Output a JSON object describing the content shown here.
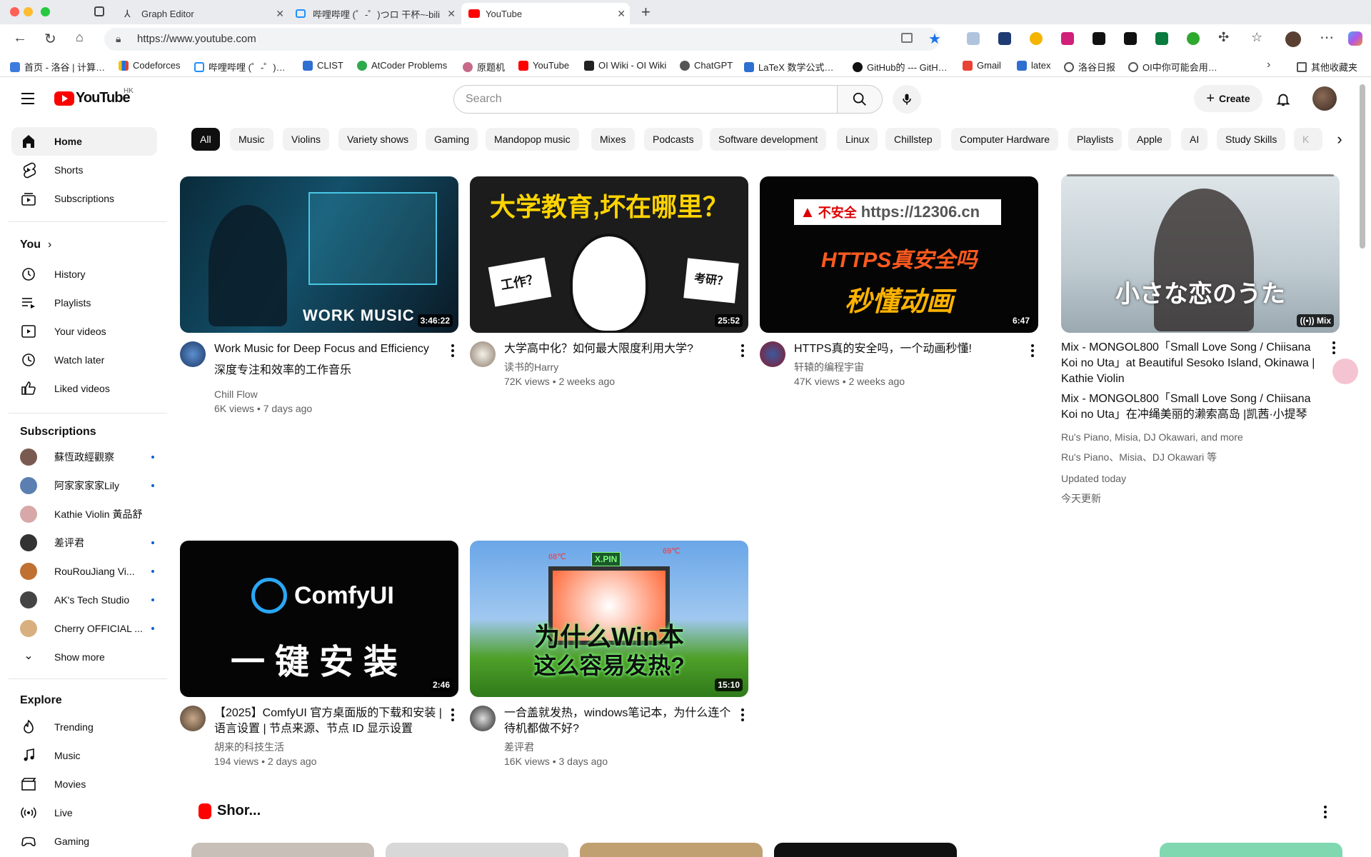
{
  "browser": {
    "tabs": [
      {
        "title": "Graph Editor"
      },
      {
        "title": "哔哩哔哩 (゜-゜)つロ 干杯~-bili"
      },
      {
        "title": "YouTube"
      }
    ],
    "url": "https://www.youtube.com",
    "bookmarks": [
      "首页 - 洛谷 | 计算…",
      "Codeforces",
      "哔哩哔哩 (゜-゜)…",
      "CLIST",
      "AtCoder Problems",
      "原题机",
      "YouTube",
      "OI Wiki - OI Wiki",
      "ChatGPT",
      "LaTeX 数学公式…",
      "GitHub的 --- GitH…",
      "Gmail",
      "latex",
      "洛谷日报",
      "OI中你可能会用…",
      "其他收藏夹"
    ]
  },
  "header": {
    "logo_text": "YouTube",
    "region": "HK",
    "search_placeholder": "Search",
    "create_label": "Create"
  },
  "sidebar": {
    "main": [
      {
        "label": "Home",
        "icon": "home-icon"
      },
      {
        "label": "Shorts",
        "icon": "shorts-icon"
      },
      {
        "label": "Subscriptions",
        "icon": "subscriptions-icon"
      }
    ],
    "you_heading": "You",
    "you": [
      {
        "label": "History",
        "icon": "history-icon"
      },
      {
        "label": "Playlists",
        "icon": "playlists-icon"
      },
      {
        "label": "Your videos",
        "icon": "your-videos-icon"
      },
      {
        "label": "Watch later",
        "icon": "watch-later-icon"
      },
      {
        "label": "Liked videos",
        "icon": "liked-videos-icon"
      }
    ],
    "subs_heading": "Subscriptions",
    "subs": [
      {
        "label": "蘇恆政經觀察",
        "color": "#7a5a50",
        "dot": true
      },
      {
        "label": "阿家家家家Lily",
        "color": "#5b7fb0",
        "dot": true
      },
      {
        "label": "Kathie Violin 黃品舒",
        "color": "#d8a8a8",
        "dot": false
      },
      {
        "label": "差评君",
        "color": "#333333",
        "dot": true
      },
      {
        "label": "RouRouJiang Vi...",
        "color": "#c07030",
        "dot": true
      },
      {
        "label": "AK's Tech Studio",
        "color": "#444444",
        "dot": true
      },
      {
        "label": "Cherry OFFICIAL ...",
        "color": "#d8b080",
        "dot": true
      }
    ],
    "show_more": "Show more",
    "explore_heading": "Explore",
    "explore": [
      {
        "label": "Trending",
        "icon": "trending-icon"
      },
      {
        "label": "Music",
        "icon": "music-icon"
      },
      {
        "label": "Movies",
        "icon": "movies-icon"
      },
      {
        "label": "Live",
        "icon": "live-icon"
      },
      {
        "label": "Gaming",
        "icon": "gaming-icon"
      }
    ]
  },
  "chips": [
    "All",
    "Music",
    "Violins",
    "Variety shows",
    "Gaming",
    "Mandopop music",
    "Mixes",
    "Podcasts",
    "Software development",
    "Linux",
    "Chillstep",
    "Computer Hardware",
    "Playlists",
    "Apple",
    "AI",
    "Study Skills",
    "K"
  ],
  "videos": [
    {
      "title": "Work Music for Deep Focus and Efficiency",
      "title2": "深度专注和效率的工作音乐",
      "channel": "Chill Flow",
      "meta": "6K views • 7 days ago",
      "duration": "3:46:22",
      "thumb_text": "WORK MUSIC"
    },
    {
      "title": "大学高中化？如何最大限度利用大学?",
      "channel": "读书的Harry",
      "meta": "72K views • 2 weeks ago",
      "duration": "25:52",
      "thumb_text": "大学教育,坏在哪里？",
      "sign1": "工作？",
      "sign2": "考研？"
    },
    {
      "title": "HTTPS真的安全吗，一个动画秒懂!",
      "channel": "轩辕的编程宇宙",
      "meta": "47K views • 2 weeks ago",
      "duration": "6:47",
      "thumb_url": "https://12306.cn",
      "thumb_warn": "不安全",
      "thumb_line1": "HTTPS真安全吗",
      "thumb_line2": "秒懂动画"
    },
    {
      "title": "Mix - MONGOL800「Small Love Song / Chiisana Koi no Uta」at Beautiful Sesoko Island, Okinawa | Kathie Violin",
      "title2": "Mix - MONGOL800「Small Love Song / Chiisana Koi no Uta」在冲绳美丽的濑索高岛 |凯茜·小提琴",
      "channel": "Ru's Piano, Misia, DJ Okawari, and more",
      "channel2": "Ru's Piano、Misia、DJ Okawari 等",
      "meta": "Updated today",
      "meta2": "今天更新",
      "duration": "Mix",
      "thumb_text": "小さな恋のうた"
    },
    {
      "title": "【2025】ComfyUI 官方桌面版的下载和安装 | 语言设置 | 节点来源、节点 ID 显示设置",
      "channel": "胡来的科技生活",
      "meta": "194 views • 2 days ago",
      "duration": "2:46",
      "thumb_brand": "ComfyUI",
      "thumb_text": "一键安装"
    },
    {
      "title": "一合盖就发热，windows笔记本，为什么连个待机都做不好?",
      "channel": "差评君",
      "meta": "16K views • 3 days ago",
      "duration": "15:10",
      "thumb_line1": "为什么Win本",
      "thumb_line2": "这么容易发热?",
      "thumb_badge": "X.PIN",
      "thumb_temp1": "68℃",
      "thumb_temp2": "69℃"
    }
  ],
  "shorts_heading": "Shor..."
}
